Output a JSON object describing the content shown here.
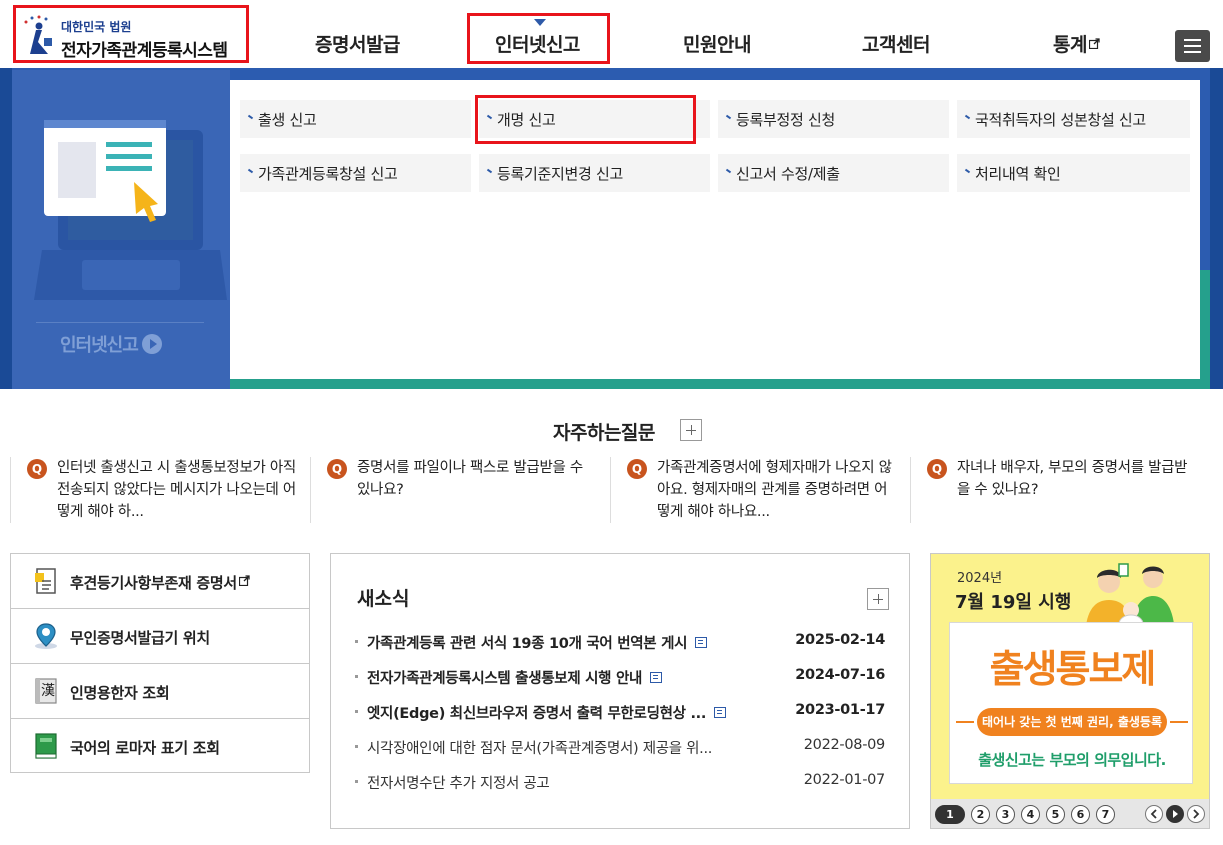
{
  "header": {
    "court_label": "대한민국 법원",
    "system_title": "전자가족관계등록시스템",
    "nav": [
      {
        "label": "증명서발급"
      },
      {
        "label": "인터넷신고"
      },
      {
        "label": "민원안내"
      },
      {
        "label": "고객센터"
      },
      {
        "label": "통계"
      }
    ]
  },
  "mega_menu": {
    "caption": "인터넷신고",
    "items": [
      {
        "label": "출생 신고"
      },
      {
        "label": "개명 신고"
      },
      {
        "label": "등록부정정 신청"
      },
      {
        "label": "국적취득자의 성본창설 신고"
      },
      {
        "label": "가족관계등록창설 신고"
      },
      {
        "label": "등록기준지변경 신고"
      },
      {
        "label": "신고서 수정/제출"
      },
      {
        "label": "처리내역 확인"
      }
    ]
  },
  "faq": {
    "title": "자주하는질문",
    "q_label": "Q",
    "items": [
      {
        "text": "인터넷 출생신고 시 출생통보정보가 아직 전송되지 않았다는 메시지가 나오는데 어떻게 해야 하..."
      },
      {
        "text": "증명서를 파일이나 팩스로 발급받을 수 있나요?"
      },
      {
        "text": "가족관계증명서에 형제자매가 나오지 않아요. 형제자매의 관계를 증명하려면 어떻게 해야 하나요..."
      },
      {
        "text": "자녀나 배우자, 부모의 증명서를 발급받을 수 있나요?"
      }
    ]
  },
  "quick_links": [
    {
      "label": "후견등기사항부존재 증명서"
    },
    {
      "label": "무인증명서발급기 위치"
    },
    {
      "label": "인명용한자 조회"
    },
    {
      "label": "국어의 로마자 표기 조회"
    }
  ],
  "news": {
    "title": "새소식",
    "items": [
      {
        "title": "가족관계등록 관련 서식 19종 10개 국어 번역본 게시",
        "date": "2025-02-14"
      },
      {
        "title": "전자가족관계등록시스템 출생통보제 시행 안내",
        "date": "2024-07-16"
      },
      {
        "title": "엣지(Edge) 최신브라우저 증명서 출력 무한로딩현상 ...",
        "date": "2023-01-17"
      },
      {
        "title": "시각장애인에 대한 점자 문서(가족관계증명서) 제공을 위...",
        "date": "2022-08-09"
      },
      {
        "title": "전자서명수단 추가 지정서 공고",
        "date": "2022-01-07"
      }
    ]
  },
  "banner": {
    "year": "2024년",
    "date": "7월 19일 시행",
    "headline": "출생통보제",
    "pill": "태어나 갖는 첫 번째 권리, 출생등록",
    "duty": "출생신고는 부모의 의무입니다.",
    "pages": [
      "1",
      "2",
      "3",
      "4",
      "5",
      "6",
      "7"
    ],
    "active_page": "1"
  },
  "colors": {
    "highlight_red": "#e8141b",
    "panel_blue": "#2c5cb0",
    "faq_badge": "#c8541e",
    "banner_yellow": "#fbf28c",
    "banner_orange": "#f0821f",
    "banner_green": "#1f9e6a"
  }
}
